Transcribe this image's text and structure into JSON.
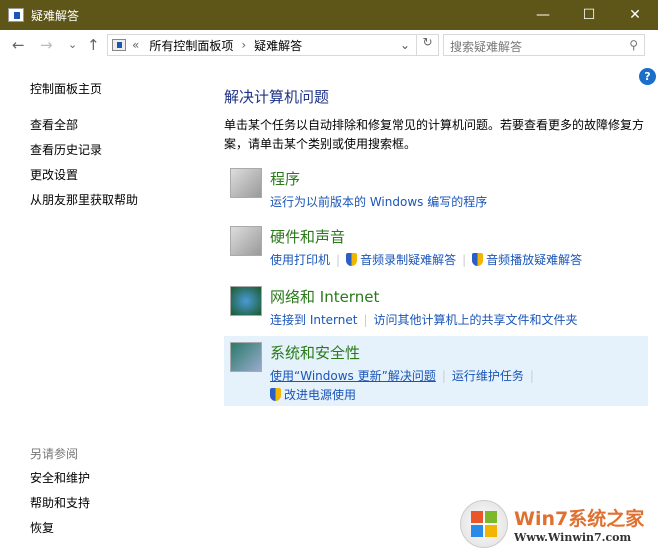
{
  "window": {
    "title": "疑难解答",
    "min": "—",
    "max": "☐",
    "close": "✕"
  },
  "address": {
    "back": "←",
    "forward": "→",
    "recent": "⌄",
    "up": "↑",
    "chevron": "«",
    "crumbs": [
      "所有控制面板项",
      "疑难解答"
    ],
    "sep": "›",
    "dropdown": "⌄",
    "refresh": "↻",
    "search_placeholder": "搜索疑难解答",
    "search_icon": "⚲"
  },
  "help": "?",
  "sidebar": {
    "home": "控制面板主页",
    "items": [
      "查看全部",
      "查看历史记录",
      "更改设置",
      "从朋友那里获取帮助"
    ],
    "see_also": "另请参阅",
    "see_items": [
      "安全和维护",
      "帮助和支持",
      "恢复"
    ]
  },
  "main": {
    "title": "解决计算机问题",
    "desc": "单击某个任务以自动排除和修复常见的计算机问题。若要查看更多的故障修复方案，请单击某个类别或使用搜索框。",
    "categories": [
      {
        "title": "程序",
        "links": [
          "运行为以前版本的 Windows 编写的程序"
        ]
      },
      {
        "title": "硬件和声音",
        "links": [
          "使用打印机",
          "音频录制疑难解答",
          "音频播放疑难解答"
        ]
      },
      {
        "title": "网络和 Internet",
        "links": [
          "连接到 Internet",
          "访问其他计算机上的共享文件和文件夹"
        ]
      },
      {
        "title": "系统和安全性",
        "links": [
          "使用“Windows 更新”解决问题",
          "运行维护任务",
          "改进电源使用"
        ]
      }
    ]
  },
  "watermark": {
    "brand": "Win7系统之家",
    "url": "Www.Winwin7.com"
  }
}
